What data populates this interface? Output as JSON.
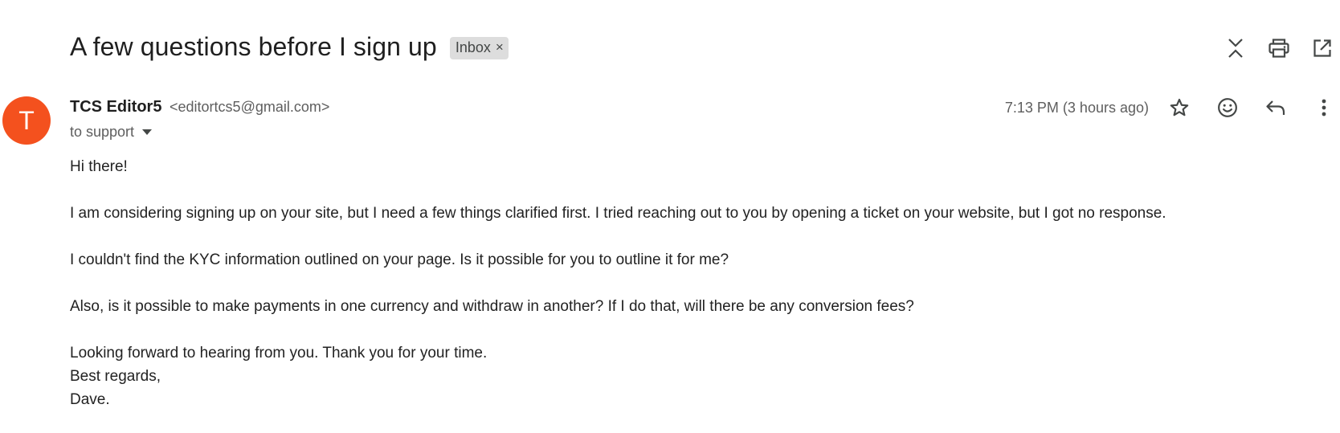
{
  "email": {
    "subject": "A few questions before I sign up",
    "label": "Inbox",
    "label_remove": "×",
    "sender": {
      "avatar_letter": "T",
      "avatar_color": "#f4511e",
      "name": "TCS Editor5",
      "email": "<editortcs5@gmail.com>"
    },
    "recipient": "to support",
    "timestamp": "7:13 PM (3 hours ago)",
    "body": {
      "greeting": "Hi there!",
      "paragraph1": "I am considering signing up on your site, but I need a few things clarified first. I tried reaching out to you by opening a ticket on your website, but I got no response.",
      "paragraph2": "I couldn't find the KYC information outlined on your page. Is it possible for you to outline it for me?",
      "paragraph3": "Also, is it possible to make payments in one currency and withdraw in another? If I do that, will there be any conversion fees?",
      "closing1": "Looking forward to hearing from you. Thank you for your time.",
      "closing2": "Best regards,",
      "signature": "Dave."
    }
  },
  "icons": {
    "top": [
      "collapse-all-icon",
      "print-icon",
      "open-in-new-window-icon"
    ],
    "message": [
      "star-icon",
      "emoji-reaction-icon",
      "reply-icon",
      "more-options-icon"
    ]
  }
}
